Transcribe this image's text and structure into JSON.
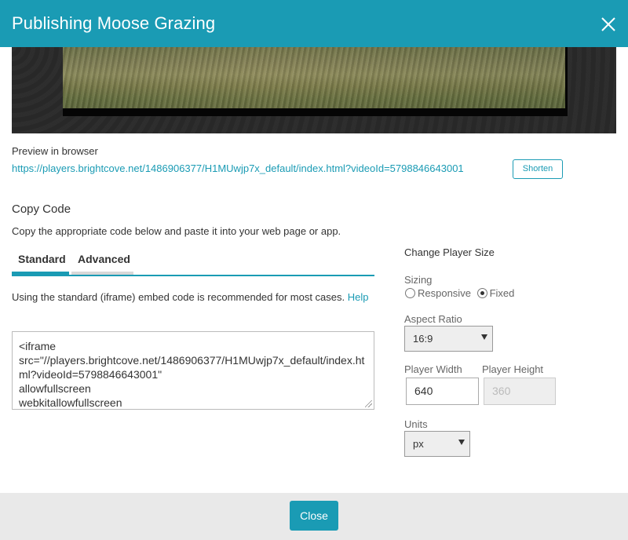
{
  "dialog": {
    "title": "Publishing Moose Grazing",
    "close_icon": "close-icon"
  },
  "preview": {
    "label": "Preview in browser",
    "url": "https://players.brightcove.net/1486906377/H1MUwjp7x_default/index.html?videoId=5798846643001",
    "shorten_label": "Shorten"
  },
  "copy_code": {
    "title": "Copy Code",
    "description": "Copy the appropriate code below and paste it into your web page or app.",
    "tabs": [
      {
        "label": "Standard",
        "active": true
      },
      {
        "label": "Advanced",
        "active": false
      }
    ],
    "embed_description": "Using the standard (iframe) embed code is recommended for most cases.",
    "help_label": "Help",
    "code": "<iframe\nsrc=\"//players.brightcove.net/1486906377/H1MUwjp7x_default/index.html?videoId=5798846643001\"\nallowfullscreen\nwebkitallowfullscreen"
  },
  "player_size": {
    "title": "Change Player Size",
    "sizing_label": "Sizing",
    "sizing_options": [
      {
        "label": "Responsive",
        "selected": false
      },
      {
        "label": "Fixed",
        "selected": true
      }
    ],
    "aspect_ratio_label": "Aspect Ratio",
    "aspect_ratio_value": "16:9",
    "width_label": "Player Width",
    "width_value": "640",
    "height_label": "Player Height",
    "height_value": "360",
    "units_label": "Units",
    "units_value": "px"
  },
  "footer": {
    "close_label": "Close"
  },
  "colors": {
    "accent": "#1a9bb4",
    "footer_bg": "#e9e9e9"
  }
}
